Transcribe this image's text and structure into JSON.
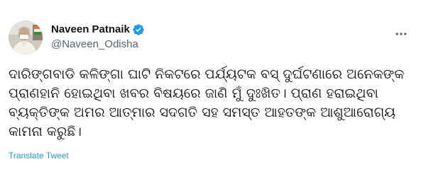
{
  "tweet": {
    "author": {
      "name": "Naveen Patnaik",
      "handle": "@Naveen_Odisha",
      "verified": true,
      "avatar_icon": "profile-photo"
    },
    "more_icon": "more-horizontal-icon",
    "text": "ଦାରିଙ୍ଗବାଡି କଳିଙ୍ଗା ଘାଟି ନିକଟରେ ପର୍ଯ୍ୟଟକ ବସ୍ ଦୁର୍ଘଟଣାରେ ଅନେକଙ୍କ ପ୍ରାଣହାନି ହୋଇଥିବା ଖବର ବିଷୟରେ ଜାଣି ମୁଁ ଦୁଃଖିତ। ପ୍ରାଣ ହରାଇଥିବା ବ୍ୟକ୍ତିଙ୍କ ଅମର ଆତ୍ମାର ସଦଗତି ସହ ସମସ୍ତ ଆହତଙ୍କ ଆଶୁଆରୋଗ୍ୟ କାମନା କରୁଛି।",
    "translate_label": "Translate Tweet",
    "colors": {
      "link": "#1d9bf0",
      "verified": "#1d9bf0",
      "secondary_text": "#536471",
      "primary_text": "#0f1419"
    }
  }
}
